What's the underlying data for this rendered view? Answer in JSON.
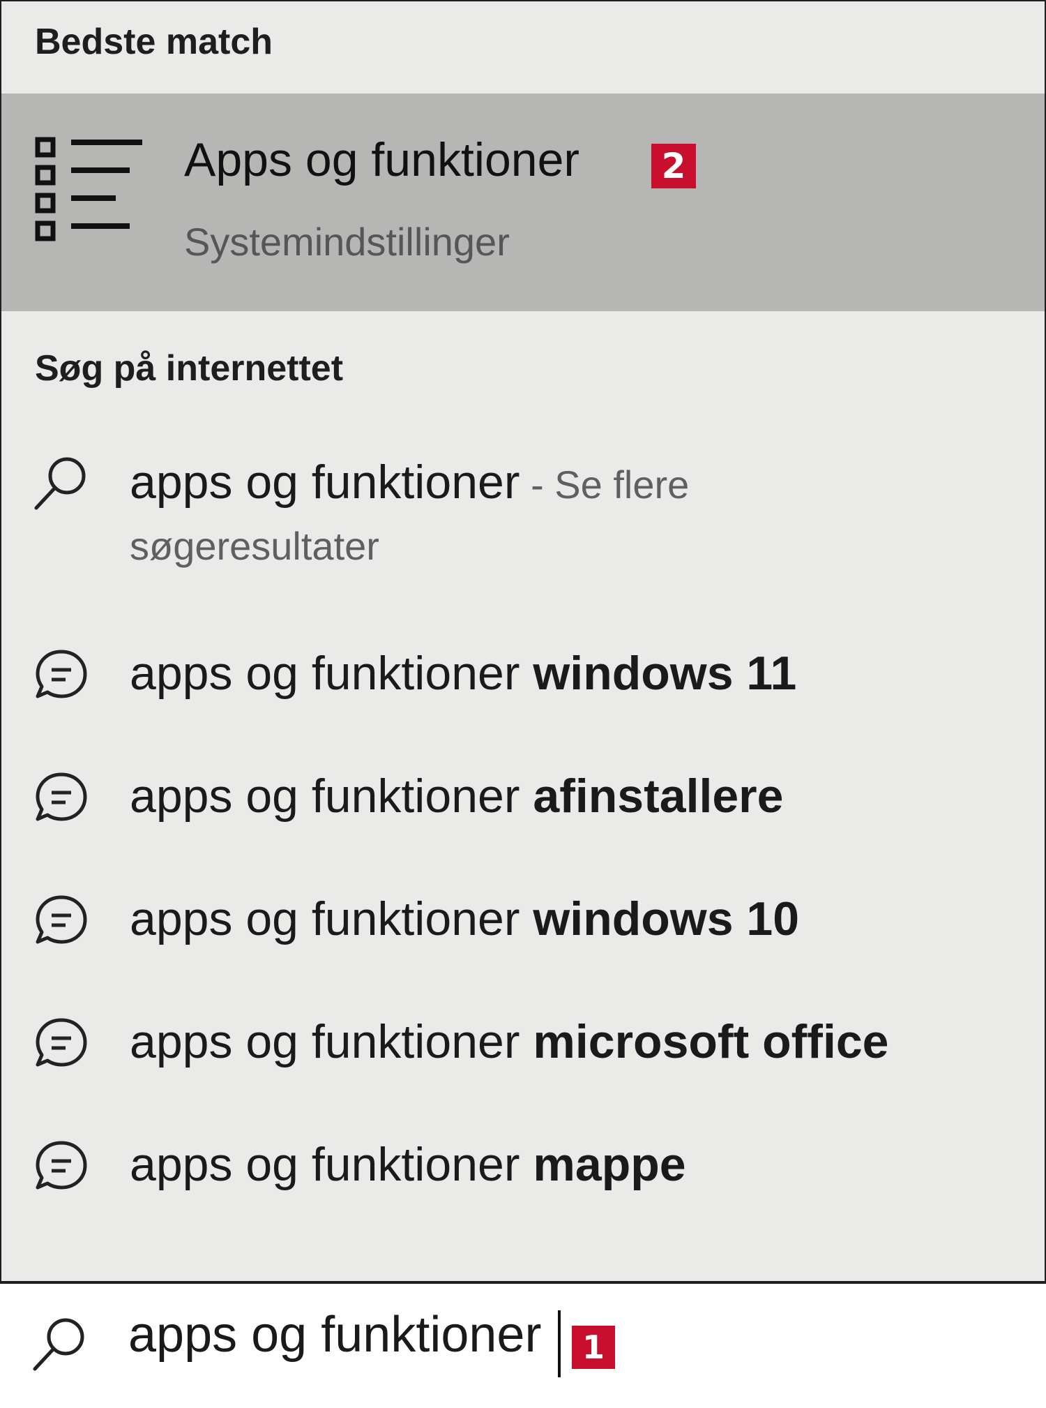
{
  "best_match": {
    "heading": "Bedste match",
    "title": "Apps og funktioner",
    "subtitle": "Systemindstillinger",
    "marker": "2",
    "icon": "list-settings-icon"
  },
  "web": {
    "heading": "Søg på internettet",
    "first": {
      "text": "apps og funktioner",
      "suffix": " - Se flere",
      "continuation": "søgeresultater",
      "icon": "search-icon"
    },
    "suggestions": [
      {
        "prefix": "apps og funktioner ",
        "bold": "windows 11",
        "icon": "chat-bubble-icon"
      },
      {
        "prefix": "apps og funktioner ",
        "bold": "afinstallere",
        "icon": "chat-bubble-icon"
      },
      {
        "prefix": "apps og funktioner ",
        "bold": "windows 10",
        "icon": "chat-bubble-icon"
      },
      {
        "prefix": "apps og funktioner ",
        "bold": "microsoft office",
        "icon": "chat-bubble-icon"
      },
      {
        "prefix": "apps og funktioner ",
        "bold": "mappe",
        "icon": "chat-bubble-icon"
      }
    ]
  },
  "search": {
    "value": "apps og funktioner",
    "marker": "1",
    "icon": "search-icon"
  },
  "colors": {
    "panel_bg": "#eaeae9",
    "highlight_bg": "#b6b6b5",
    "marker_red": "#c8102e"
  }
}
